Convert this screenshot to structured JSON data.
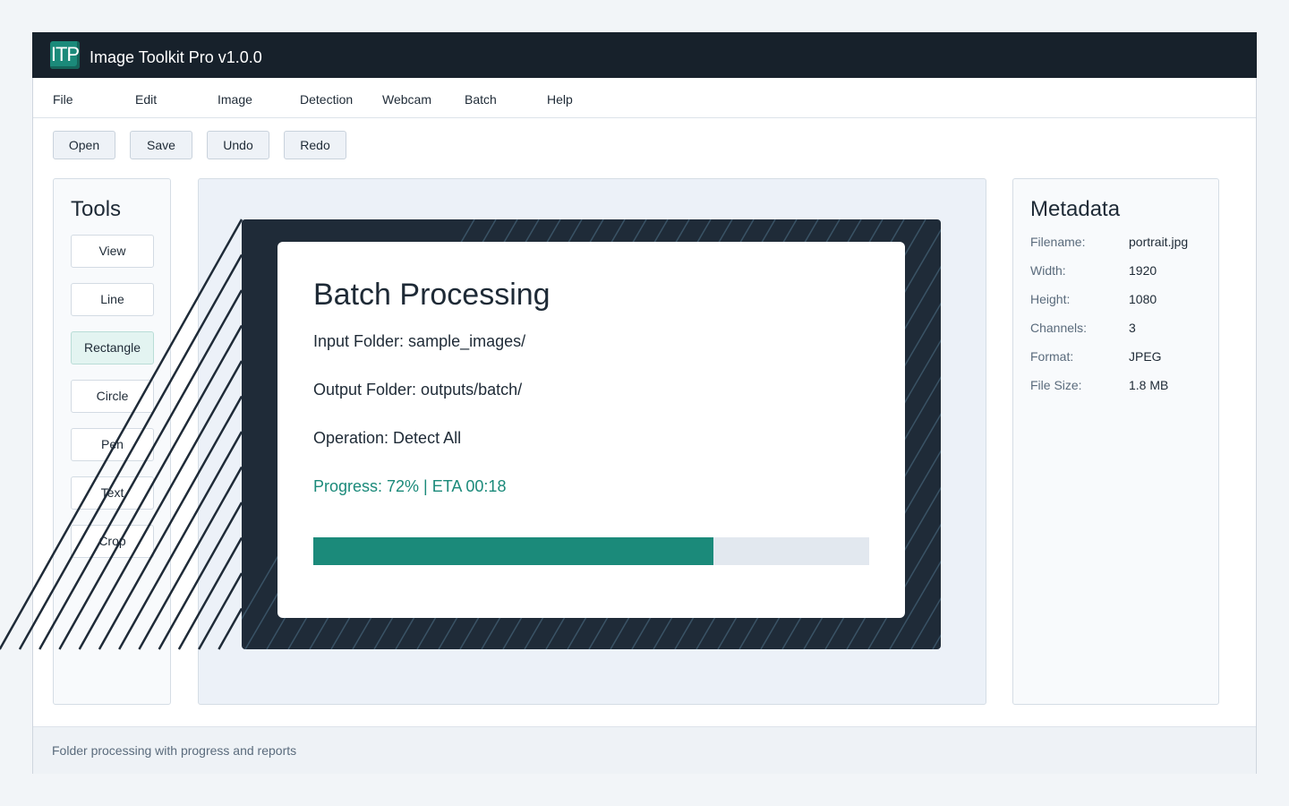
{
  "app": {
    "logo_text": "ITP",
    "title": "Image Toolkit Pro v1.0.0"
  },
  "menu": [
    "File",
    "Edit",
    "Image",
    "Detection",
    "Webcam",
    "Batch",
    "Help"
  ],
  "toolbar": {
    "open": "Open",
    "save": "Save",
    "undo": "Undo",
    "redo": "Redo"
  },
  "tools": {
    "title": "Tools",
    "items": [
      "View",
      "Line",
      "Rectangle",
      "Circle",
      "Pen",
      "Text",
      "Crop"
    ],
    "active": "Rectangle"
  },
  "metadata": {
    "title": "Metadata",
    "rows": [
      {
        "key": "Filename:",
        "value": "portrait.jpg"
      },
      {
        "key": "Width:",
        "value": "1920"
      },
      {
        "key": "Height:",
        "value": "1080"
      },
      {
        "key": "Channels:",
        "value": "3"
      },
      {
        "key": "Format:",
        "value": "JPEG"
      },
      {
        "key": "File Size:",
        "value": "1.8 MB"
      }
    ]
  },
  "status": "Folder processing with progress and reports",
  "dialog": {
    "title": "Batch Processing",
    "input_folder": "Input Folder: sample_images/",
    "output_folder": "Output Folder: outputs/batch/",
    "operation": "Operation: Detect All",
    "progress_text": "Progress: 72% | ETA 00:18",
    "progress_fraction": 0.72
  },
  "colors": {
    "accent": "#1b8a7a",
    "titlebar": "#17212b",
    "dialog_frame": "#1f2b38"
  }
}
